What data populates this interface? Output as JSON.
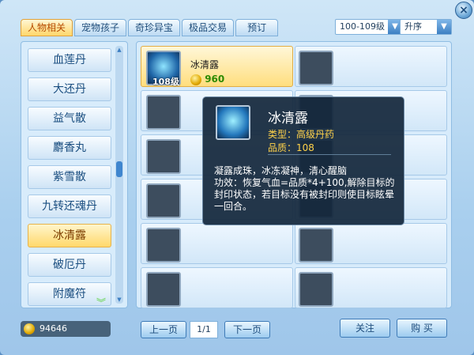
{
  "tabs": [
    "人物相关",
    "宠物孩子",
    "奇珍异宝",
    "极品交易",
    "预订"
  ],
  "level_filter": "100-109级",
  "sort": "升序",
  "left_items": [
    "血莲丹",
    "大还丹",
    "益气散",
    "麝香丸",
    "紫雪散",
    "九转还魂丹",
    "冰清露",
    "破厄丹",
    "附魔符"
  ],
  "active_item": "冰清露",
  "item": {
    "name": "冰清露",
    "level": "108级",
    "price": "960"
  },
  "tooltip": {
    "title": "冰清露",
    "type": "类型：高级丹药",
    "quality": "品质：108",
    "desc1": "凝露成珠，冰冻凝神，清心醒脑",
    "desc2": "功效：恢复气血=品质*4+100,解除目标的封印状态，若目标没有被封印则使目标眩晕一回合。"
  },
  "money": "94646",
  "prev": "上一页",
  "page": "1/1",
  "next": "下一页",
  "focus_label": "关注",
  "buy_label": "购 买",
  "colors": {
    "accent": "#ffd76b",
    "panel": "#d7ebfb",
    "tooltip": "#14283c"
  }
}
